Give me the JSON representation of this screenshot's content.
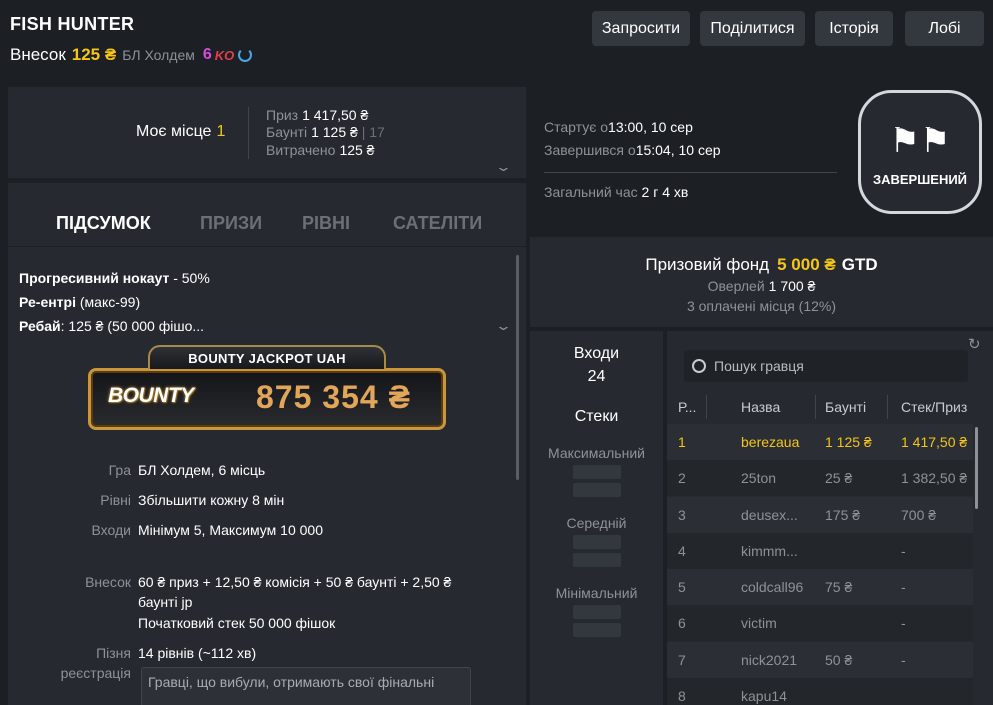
{
  "header": {
    "title": "FISH HUNTER",
    "buyin_label": "Внесок",
    "buyin_amount": "125 ₴",
    "game": "БЛ Холдем",
    "ko_number": "6",
    "ko_badge": "KO"
  },
  "top_buttons": {
    "register": "Запросити",
    "share": "Поділитися",
    "history": "Історія",
    "lobby": "Лобі"
  },
  "my_place": {
    "label": "Моє місце",
    "value": "1",
    "prize_label": "Приз",
    "prize_value": "1 417,50 ₴",
    "bounty_label": "Баунті",
    "bounty_value": "1 125 ₴",
    "bounty_sep": "|",
    "bounty_count": "17",
    "spent_label": "Витрачено",
    "spent_value": "125 ₴"
  },
  "tabs": [
    "ПІДСУМОК",
    "ПРИЗИ",
    "РІВНІ",
    "САТЕЛІТИ"
  ],
  "summary": {
    "line1_bold": "Прогресивний нокаут",
    "line1_rest": " - 50%",
    "line2_bold": "Ре-ентрі",
    "line2_rest": " (макс-99)",
    "line3_bold": "Ребай",
    "line3_rest": ": 125 ₴ (50 000 фішо..."
  },
  "jackpot": {
    "banner": "BOUNTY JACKPOT UAH",
    "logo": "BOUNTY",
    "amount": "875 354 ₴"
  },
  "details": {
    "game_label": "Гра",
    "game_value": "БЛ Холдем, 6 місць",
    "levels_label": "Рівні",
    "levels_value": "Збільшити кожну 8 мін",
    "entries_label": "Входи",
    "entries_value": "Мінімум 5, Максимум 10 000",
    "buyin_label": "Внесок",
    "buyin_value_1": "60 ₴ приз + 12,50 ₴ комісія + 50 ₴ баунті + 2,50 ₴",
    "buyin_value_2": "баунті jp",
    "buyin_value_3": "Початковий стек 50 000 фішок",
    "late_label_1": "Пізня",
    "late_label_2": "реєстрація",
    "late_value": "14 рівнів (~112 хв)",
    "tooltip": "Гравці, що вибули, отримають свої фінальні"
  },
  "schedule": {
    "start_label": "Стартує о",
    "start_value": "13:00, 10 сер",
    "end_label": "Завершився о",
    "end_value": "15:04, 10 сер",
    "total_label": "Загальний час",
    "total_value": "2 г 4 хв",
    "status": "ЗАВЕРШЕНИЙ"
  },
  "prize_pool": {
    "label": "Призовий фонд",
    "amount": "5 000 ₴",
    "gtd": "GTD",
    "overlay_label": "Оверлей",
    "overlay_value": "1 700 ₴",
    "paid": "3 оплачені місця (12%)"
  },
  "entries": {
    "label": "Входи",
    "value": "24",
    "stacks": "Стеки",
    "max": "Максимальний",
    "avg": "Середній",
    "min": "Мінімальний"
  },
  "players": {
    "search_placeholder": "Пошук гравця",
    "columns": [
      "Р...",
      "Назва",
      "Баунті",
      "Стек/Приз"
    ],
    "rows": [
      {
        "rank": "1",
        "name": "berezaua",
        "bounty": "1 125 ₴",
        "prize": "1 417,50 ₴"
      },
      {
        "rank": "2",
        "name": "25ton",
        "bounty": "25 ₴",
        "prize": "1 382,50 ₴"
      },
      {
        "rank": "3",
        "name": "deusex...",
        "bounty": "175 ₴",
        "prize": "700 ₴"
      },
      {
        "rank": "4",
        "name": "kimmm...",
        "bounty": "",
        "prize": "-"
      },
      {
        "rank": "5",
        "name": "coldcall96",
        "bounty": "75 ₴",
        "prize": "-"
      },
      {
        "rank": "6",
        "name": "victim",
        "bounty": "",
        "prize": "-"
      },
      {
        "rank": "7",
        "name": "nick2021",
        "bounty": "50 ₴",
        "prize": "-"
      },
      {
        "rank": "8",
        "name": "kapu14",
        "bounty": "",
        "prize": ""
      }
    ]
  }
}
